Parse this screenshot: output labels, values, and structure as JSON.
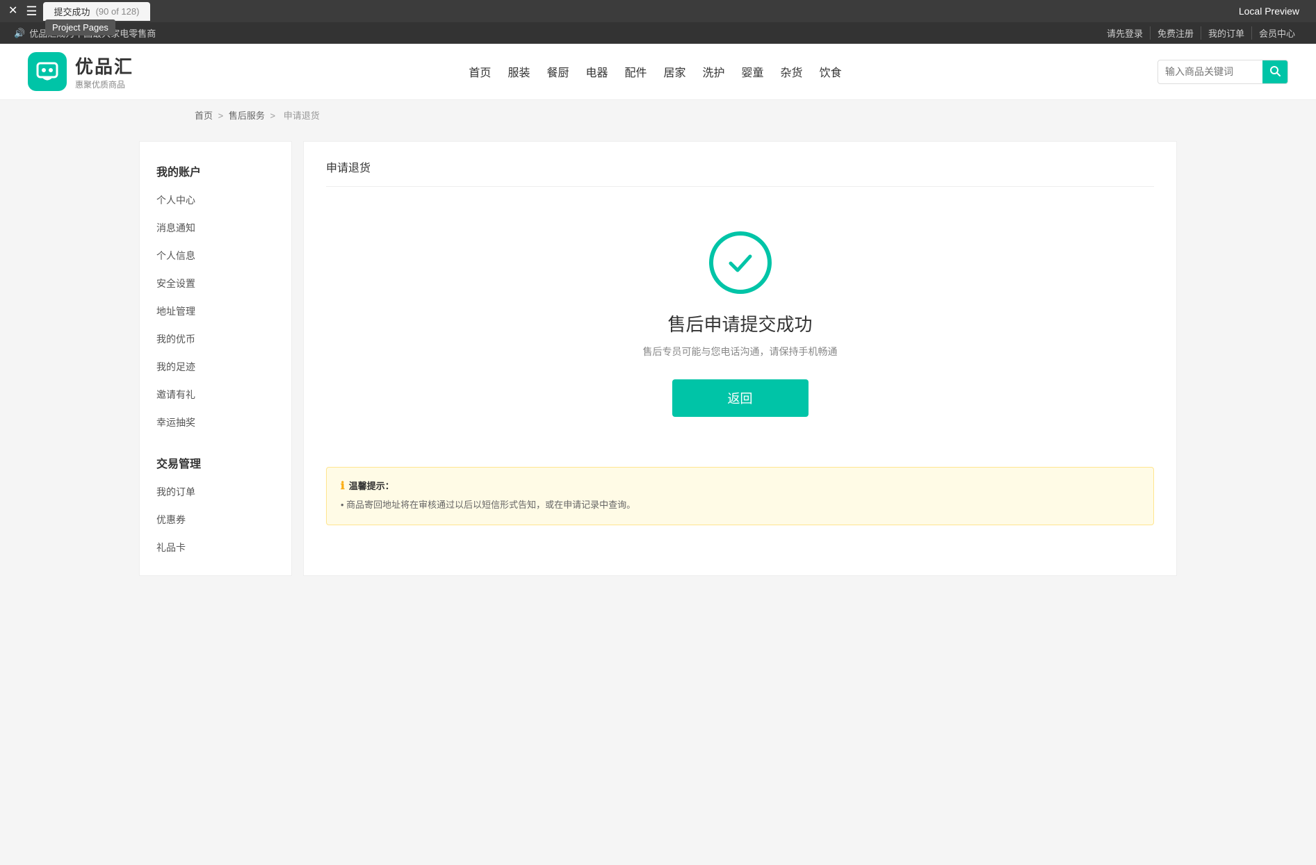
{
  "browser": {
    "close_label": "✕",
    "menu_label": "☰",
    "tab_label": "提交成功",
    "tab_count": "(90 of 128)",
    "preview_label": "Local Preview",
    "tooltip_label": "Project Pages"
  },
  "topbar": {
    "announcement_icon": "🔊",
    "announcement_text": "优品汇成为中国最大家电零售商",
    "links": [
      "请先登录",
      "免费注册",
      "我的订单",
      "会员中心"
    ]
  },
  "header": {
    "logo_name": "优品汇",
    "logo_slogan": "惠聚优质商品",
    "nav_items": [
      "首页",
      "服装",
      "餐厨",
      "电器",
      "配件",
      "居家",
      "洗护",
      "婴童",
      "杂货",
      "饮食"
    ],
    "search_placeholder": "输入商品关键词"
  },
  "breadcrumb": {
    "home": "首页",
    "sep1": ">",
    "aftersale": "售后服务",
    "sep2": ">",
    "current": "申请退货"
  },
  "sidebar": {
    "account_title": "我的账户",
    "account_items": [
      "个人中心",
      "消息通知",
      "个人信息",
      "安全设置",
      "地址管理",
      "我的优币",
      "我的足迹",
      "邀请有礼",
      "幸运抽奖"
    ],
    "trade_title": "交易管理",
    "trade_items": [
      "我的订单",
      "优惠券",
      "礼品卡"
    ]
  },
  "content": {
    "page_title": "申请退货",
    "success_title": "售后申请提交成功",
    "success_desc": "售后专员可能与您电话沟通，请保持手机畅通",
    "back_btn_label": "返回",
    "warning_title": "温馨提示：",
    "warning_items": [
      "• 商品寄回地址将在审核通过以后以短信形式告知，或在申请记录中查询。"
    ]
  },
  "colors": {
    "brand": "#00c4a7",
    "warning_bg": "#fffbe6",
    "warning_border": "#ffe58f"
  }
}
